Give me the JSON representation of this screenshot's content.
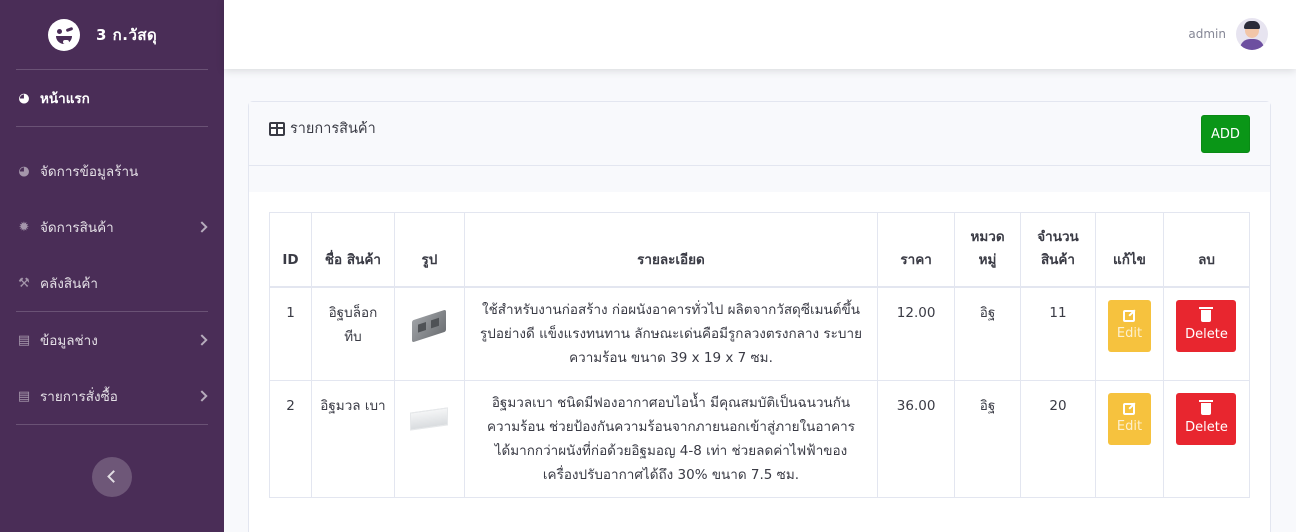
{
  "brand": {
    "name": "3 ก.วัสดุ",
    "logo_icon": "laughing-face-icon"
  },
  "sidebar": {
    "items": [
      {
        "label": "หน้าแรก",
        "icon": "gauge-icon",
        "active": true
      },
      {
        "label": "จัดการข้อมูลร้าน",
        "icon": "gauge-icon"
      },
      {
        "label": "จัดการสินค้า",
        "icon": "gear-icon",
        "has_children": true
      },
      {
        "label": "คลังสินค้า",
        "icon": "wrench-icon"
      },
      {
        "label": "ข้อมูลช่าง",
        "icon": "list-icon",
        "has_children": true
      },
      {
        "label": "รายการสั่งซื้อ",
        "icon": "list-icon",
        "has_children": true
      }
    ]
  },
  "topbar": {
    "username": "admin"
  },
  "card": {
    "title": "รายการสินค้า",
    "add_label": "ADD"
  },
  "table": {
    "headers": [
      "ID",
      "ชื่อ สินค้า",
      "รูป",
      "รายละเอียด",
      "ราคา",
      "หมวด หมู่",
      "จำนวน สินค้า",
      "แก้ไข",
      "ลบ"
    ],
    "rows": [
      {
        "id": "1",
        "name": "อิฐบล็อก ทีบ",
        "detail": "ใช้สำหรับงานก่อสร้าง ก่อผนังอาคารทั่วไป ผลิตจากวัสดุซีเมนต์ขึ้นรูปอย่างดี แข็งแรงทนทาน ลักษณะเด่นคือมีรูกลวงตรงกลาง ระบายความร้อน ขนาด 39 x 19 x 7 ซม.",
        "price": "12.00",
        "category": "อิฐ",
        "qty": "11",
        "edit_label": "Edit",
        "delete_label": "Delete"
      },
      {
        "id": "2",
        "name": "อิฐมวล เบา",
        "detail": "อิฐมวลเบา ชนิดมีฟองอากาศอบไอน้ำ มีคุณสมบัติเป็นฉนวนกันความร้อน ช่วยป้องกันความร้อนจากภายนอกเข้าสู่ภายในอาคาร ได้มากกว่าผนังที่ก่อด้วยอิฐมอญ 4-8 เท่า ช่วยลดค่าไฟฟ้าของเครื่องปรับอากาศได้ถึง 30% ขนาด 7.5 ซม.",
        "price": "36.00",
        "category": "อิฐ",
        "qty": "20",
        "edit_label": "Edit",
        "delete_label": "Delete"
      }
    ]
  },
  "colors": {
    "sidebar": "#4a2d57",
    "add": "#0a9617",
    "edit": "#f6c23e",
    "delete": "#e8262f"
  }
}
